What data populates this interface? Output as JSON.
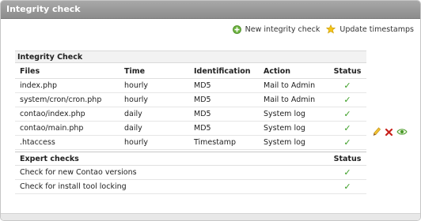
{
  "window": {
    "title": "Integrity check"
  },
  "toolbar": {
    "new_check_label": "New integrity check",
    "update_timestamps_label": "Update timestamps"
  },
  "integrity": {
    "section_title": "Integrity Check",
    "columns": [
      "Files",
      "Time",
      "Identification",
      "Action",
      "Status"
    ],
    "rows": [
      {
        "file": "index.php",
        "time": "hourly",
        "identification": "MD5",
        "action": "Mail to Admin",
        "status": "✓"
      },
      {
        "file": "system/cron/cron.php",
        "time": "hourly",
        "identification": "MD5",
        "action": "Mail to Admin",
        "status": "✓"
      },
      {
        "file": "contao/index.php",
        "time": "daily",
        "identification": "MD5",
        "action": "System log",
        "status": "✓"
      },
      {
        "file": "contao/main.php",
        "time": "daily",
        "identification": "MD5",
        "action": "System log",
        "status": "✓"
      },
      {
        "file": ".htaccess",
        "time": "hourly",
        "identification": "Timestamp",
        "action": "System log",
        "status": "✓"
      }
    ]
  },
  "expert": {
    "columns": [
      "Expert checks",
      "Status"
    ],
    "rows": [
      {
        "label": "Check for new Contao versions",
        "status": "✓"
      },
      {
        "label": "Check for install tool locking",
        "status": "✓"
      }
    ]
  },
  "icons": {
    "new_check": "plus-circle-icon",
    "update_timestamps": "star-icon",
    "edit": "pencil-icon",
    "delete": "delete-x-icon",
    "show": "eye-icon"
  },
  "colors": {
    "titlebar": "#999999",
    "check_green": "#3a9d23",
    "delete_red": "#c8201b"
  }
}
